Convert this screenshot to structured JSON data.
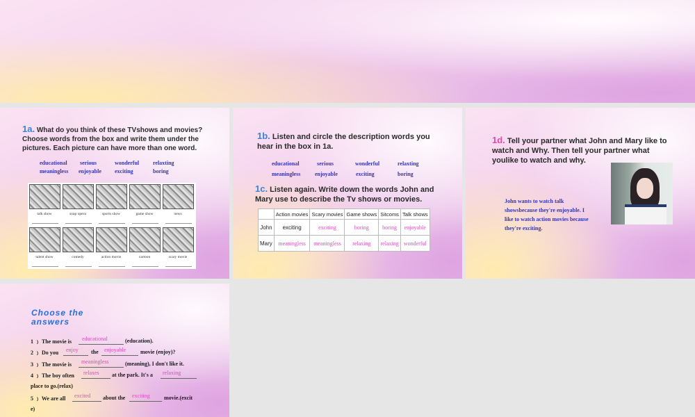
{
  "slide1a": {
    "num": "1a.",
    "instruction": "What do you think of these TVshows and movies? Choose words from the box and write them under the pictures. Each picture can have more than one word.",
    "words": [
      "educational",
      "serious",
      "wonderful",
      "relaxting",
      "meaningless",
      "enjoyable",
      "exciting",
      "boring"
    ],
    "labels_row1": [
      "talk show",
      "soap opera",
      "sports show",
      "game show",
      "news"
    ],
    "labels_row2": [
      "talent show",
      "comedy",
      "action movie",
      "cartoon",
      "scary movie"
    ]
  },
  "slide1b": {
    "num": "1b.",
    "instruction": "Listen and circle the description words you hear in the box in 1a.",
    "words": [
      "educational",
      "serious",
      "wonderful",
      "relaxting",
      "meaningless",
      "enjoyable",
      "exciting",
      "boring"
    ],
    "num_c": "1c.",
    "instruction_c": "Listen again. Write down the words John and Mary use to describe the Tv shows or movies.",
    "table": {
      "headers": [
        "Action movies",
        "Scary movies",
        "Game shows",
        "Sitcoms",
        "Talk shows"
      ],
      "rows": [
        {
          "name": "John",
          "cells": [
            "exciting",
            "exciting",
            "boring",
            "boring",
            "enjoyable"
          ]
        },
        {
          "name": "Mary",
          "cells": [
            "meaningless",
            "meaningless",
            "relaxing",
            "relaxing",
            "wonderful"
          ]
        }
      ]
    }
  },
  "slide1d": {
    "num": "1d.",
    "instruction": "Tell your partner what John and Mary like to watch and Why. Then tell your partner what youlike to watch and why.",
    "paragraph": "John wants to watch talk showsbecause they're enjoyable. I like to watch action movies because they're exciting."
  },
  "exercises": {
    "title": "Choose the answers",
    "items": [
      {
        "n": "1 ﹚",
        "a": "The movie is",
        "ans": "educational",
        "b": "(education)."
      },
      {
        "n": "2 ﹚",
        "a": "Do you",
        "ans": "enjoy",
        "b": "the",
        "ans2": "enjoyable",
        "c": "movie (enjoy)?"
      },
      {
        "n": "3 ﹚",
        "a": "The movie is",
        "ans": "meaningless",
        "b": "(meaning), I don't like it."
      },
      {
        "n": "4 ﹚",
        "a": "The boy often",
        "ans": "relaxes",
        "b": "at the park. It's a",
        "ans2": "relaxing",
        "c": "place to go.(relax)"
      },
      {
        "n": "5 ﹚",
        "a": "We are all",
        "ans": "excited",
        "b": "about the",
        "ans2": "exciting",
        "c": "movie.(excit",
        "d": "e)"
      }
    ]
  },
  "colors": {
    "accent_blue": "#3a83d6",
    "accent_pink": "#e04aa8",
    "word_blue": "#3434b8",
    "answer_pink": "#d84cbc"
  }
}
